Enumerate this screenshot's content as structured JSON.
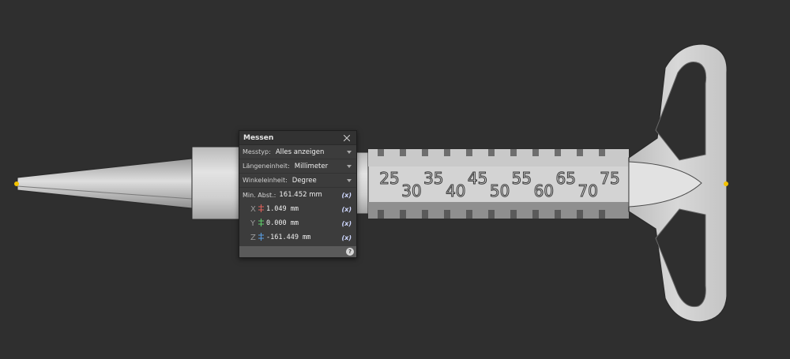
{
  "scene": {
    "scale_labels_top": [
      "25",
      "35",
      "45",
      "55",
      "65",
      "75"
    ],
    "scale_labels_bottom": [
      "30",
      "40",
      "50",
      "60",
      "70"
    ],
    "colors": {
      "background": "#2f2f2f",
      "model_light": "#d9d9d9",
      "model_mid": "#bdbdbd",
      "model_dark": "#8a8a8a",
      "edge": "#1e1e1e",
      "measure_point": "#f2c200"
    }
  },
  "measure_panel": {
    "title": "Messen",
    "close_icon": "close-icon",
    "type_label": "Messtyp:",
    "type_value": "Alles anzeigen",
    "length_unit_label": "Längeneinheit:",
    "length_unit_value": "Millimeter",
    "angle_unit_label": "Winkeleinheit:",
    "angle_unit_value": "Degree",
    "min_distance_label": "Min. Abst.:",
    "min_distance_value": "161.452 mm",
    "x_label": "X",
    "x_value": "1.049 mm",
    "y_label": "Y",
    "y_value": "0.000 mm",
    "z_label": "Z",
    "z_value": "-161.449 mm",
    "fx_label": "(x)",
    "help_label": "?",
    "axis_colors": {
      "x": "#e0605a",
      "y": "#5fce6a",
      "z": "#5aa0e6"
    }
  }
}
